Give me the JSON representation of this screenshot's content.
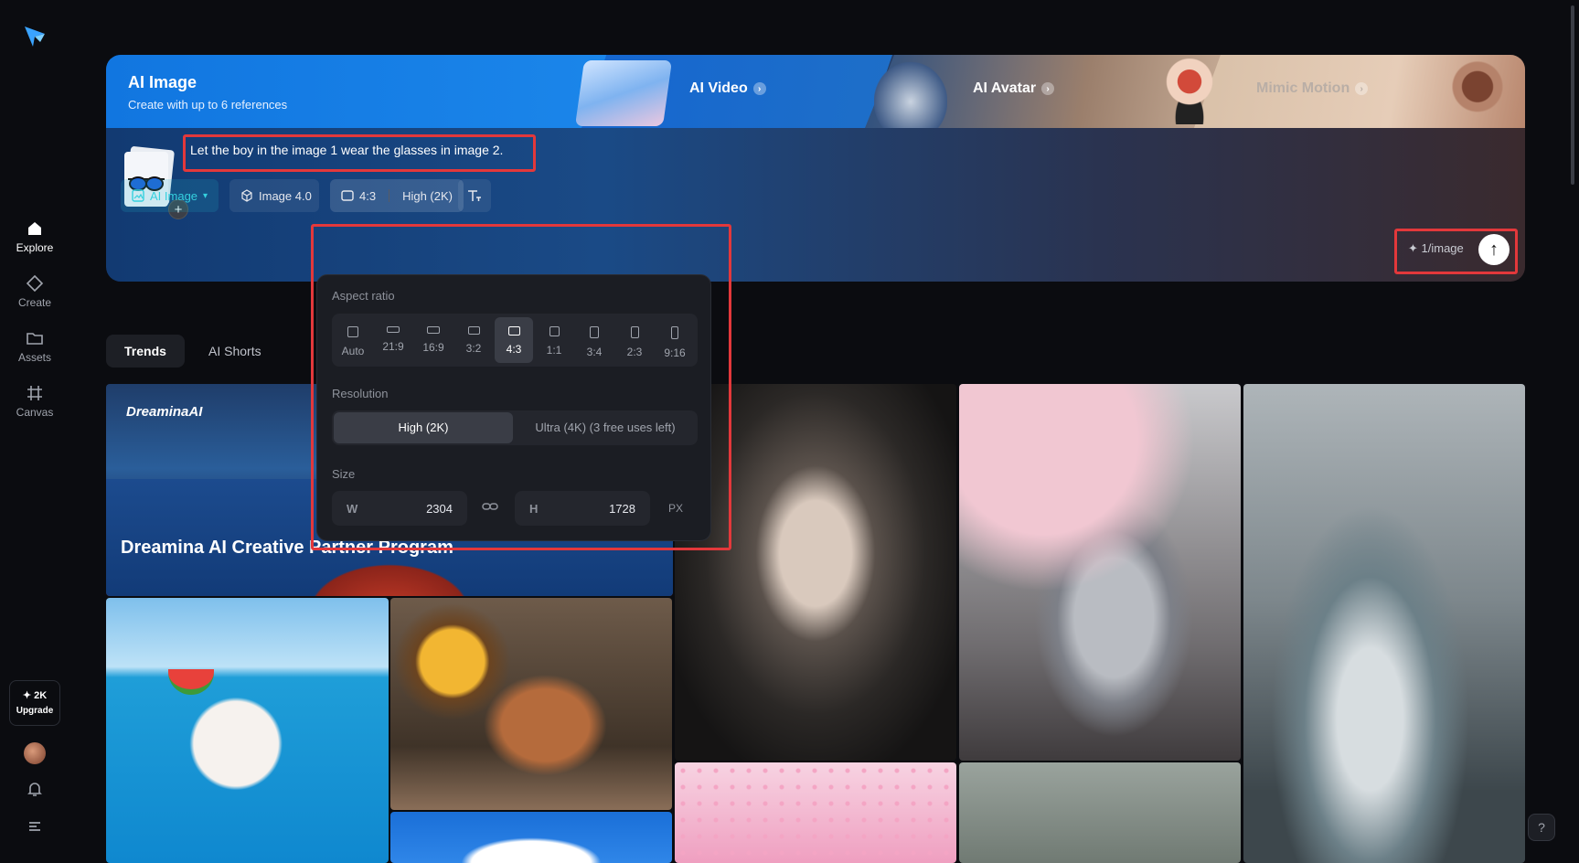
{
  "sidebar": {
    "items": [
      {
        "label": "Explore",
        "icon": "home-icon"
      },
      {
        "label": "Create",
        "icon": "diamond-icon"
      },
      {
        "label": "Assets",
        "icon": "folder-icon"
      },
      {
        "label": "Canvas",
        "icon": "canvas-grid-icon"
      }
    ],
    "upgrade": {
      "badge": "✦ 2K",
      "label": "Upgrade"
    }
  },
  "hero": {
    "title": "AI Image",
    "subtitle": "Create with up to 6 references",
    "modes": [
      "AI Video",
      "AI Avatar",
      "Mimic Motion"
    ]
  },
  "prompt": {
    "text": "Let the boy in the image 1 wear the glasses in image 2.",
    "add_reference": "+"
  },
  "toolbar": {
    "mode": "AI Image",
    "model": "Image 4.0",
    "ratio": "4:3",
    "resolution": "High (2K)",
    "cost": "✦ 1/image",
    "send": "↑"
  },
  "panel": {
    "aspect_label": "Aspect ratio",
    "ratios": [
      "Auto",
      "21:9",
      "16:9",
      "3:2",
      "4:3",
      "1:1",
      "3:4",
      "2:3",
      "9:16"
    ],
    "selected_ratio": "4:3",
    "resolution_label": "Resolution",
    "resolutions": [
      "High (2K)",
      "Ultra (4K)  (3 free uses left)"
    ],
    "size_label": "Size",
    "width_key": "W",
    "width": "2304",
    "height_key": "H",
    "height": "1728",
    "unit": "PX"
  },
  "tabs": [
    "Trends",
    "AI Shorts"
  ],
  "gallery": {
    "brand": "DreaminaAI",
    "feature_caption": "Dreamina AI Creative Partner Program"
  },
  "help": "?",
  "colors": {
    "accent": "#35d0de",
    "highlight": "#e3383b",
    "background": "#0b0c10"
  }
}
